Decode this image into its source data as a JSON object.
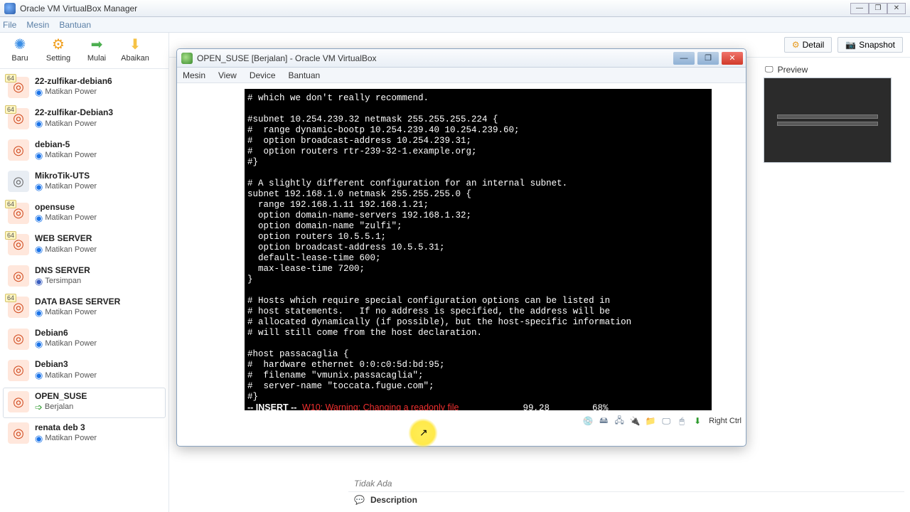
{
  "outer": {
    "title": "Oracle VM VirtualBox Manager",
    "menus": [
      "File",
      "Mesin",
      "Bantuan"
    ],
    "winbtns": [
      "—",
      "❐",
      "✕"
    ]
  },
  "toolbar": [
    {
      "label": "Baru",
      "icon": "✺",
      "cls": "blue"
    },
    {
      "label": "Setting",
      "icon": "⚙",
      "cls": "orange"
    },
    {
      "label": "Mulai",
      "icon": "➡",
      "cls": "green"
    },
    {
      "label": "Abaikan",
      "icon": "⬇",
      "cls": "ylw"
    }
  ],
  "vms": [
    {
      "name": "22-zulfikar-debian6",
      "state": "Matikan Power",
      "kind": "debian",
      "badge": "64"
    },
    {
      "name": "22-zulfikar-Debian3",
      "state": "Matikan Power",
      "kind": "debian",
      "badge": "64"
    },
    {
      "name": "debian-5",
      "state": "Matikan Power",
      "kind": "debian",
      "badge": ""
    },
    {
      "name": "MikroTik-UTS",
      "state": "Matikan Power",
      "kind": "generic",
      "badge": ""
    },
    {
      "name": "opensuse",
      "state": "Matikan Power",
      "kind": "debian",
      "badge": "64"
    },
    {
      "name": "WEB SERVER",
      "state": "Matikan Power",
      "kind": "debian",
      "badge": "64"
    },
    {
      "name": "DNS SERVER",
      "state": "Tersimpan",
      "kind": "debian",
      "badge": "",
      "state_cls": "saved"
    },
    {
      "name": "DATA BASE SERVER",
      "state": "Matikan Power",
      "kind": "debian",
      "badge": "64"
    },
    {
      "name": "Debian6",
      "state": "Matikan Power",
      "kind": "debian",
      "badge": ""
    },
    {
      "name": "Debian3",
      "state": "Matikan Power",
      "kind": "debian",
      "badge": ""
    },
    {
      "name": "OPEN_SUSE",
      "state": "Berjalan",
      "kind": "debian",
      "badge": "",
      "state_cls": "run",
      "sel": true
    },
    {
      "name": "renata deb 3",
      "state": "Matikan Power",
      "kind": "debian",
      "badge": ""
    }
  ],
  "right": {
    "detail": "Detail",
    "snapshot": "Snapshot",
    "preview": "Preview",
    "none": "Tidak Ada",
    "description": "Description"
  },
  "vmwin": {
    "title": "OPEN_SUSE [Berjalan] - Oracle VM VirtualBox",
    "menus": [
      "Mesin",
      "View",
      "Device",
      "Bantuan"
    ],
    "host_key": "Right Ctrl"
  },
  "terminal": {
    "lines": [
      "# which we don't really recommend.",
      "",
      "#subnet 10.254.239.32 netmask 255.255.255.224 {",
      "#  range dynamic-bootp 10.254.239.40 10.254.239.60;",
      "#  option broadcast-address 10.254.239.31;",
      "#  option routers rtr-239-32-1.example.org;",
      "#}",
      "",
      "# A slightly different configuration for an internal subnet.",
      "subnet 192.168.1.0 netmask 255.255.255.0 {",
      "  range 192.168.1.11 192.168.1.21;",
      "  option domain-name-servers 192.168.1.32;",
      "  option domain-name \"zulfi\";",
      "  option routers 10.5.5.1;",
      "  option broadcast-address 10.5.5.31;",
      "  default-lease-time 600;",
      "  max-lease-time 7200;",
      "}",
      "",
      "# Hosts which require special configuration options can be listed in",
      "# host statements.   If no address is specified, the address will be",
      "# allocated dynamically (if possible), but the host-specific information",
      "# will still come from the host declaration.",
      "",
      "#host passacaglia {",
      "#  hardware ethernet 0:0:c0:5d:bd:95;",
      "#  filename \"vmunix.passacaglia\";",
      "#  server-name \"toccata.fugue.com\";",
      "#}"
    ],
    "status_mode": "-- INSERT --",
    "status_warn": "W10: Warning: Changing a readonly file",
    "status_pos": "99,28",
    "status_pct": "68%"
  }
}
